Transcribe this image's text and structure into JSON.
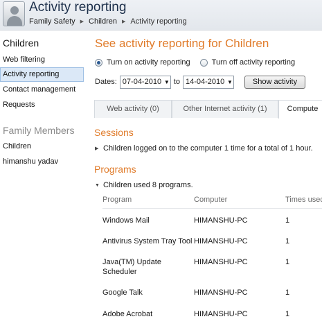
{
  "header": {
    "title": "Activity reporting",
    "breadcrumb": [
      "Family Safety",
      "Children",
      "Activity reporting"
    ]
  },
  "sidebar": {
    "heading": "Children",
    "items": [
      "Web filtering",
      "Activity reporting",
      "Contact management",
      "Requests"
    ],
    "active_index": 1,
    "members_heading": "Family Members",
    "members": [
      "Children",
      "himanshu yadav"
    ]
  },
  "main": {
    "title": "See activity reporting for Children",
    "radio_on": "Turn on activity reporting",
    "radio_off": "Turn off activity reporting",
    "radio_selected": "on",
    "dates_label": "Dates:",
    "date_from": "07-04-2010",
    "date_to_label": "to",
    "date_to": "14-04-2010",
    "show_button": "Show activity",
    "tabs": [
      "Web activity (0)",
      "Other Internet activity (1)",
      "Compute"
    ],
    "active_tab": 2,
    "sessions": {
      "title": "Sessions",
      "summary": "Children logged on to the computer 1 time for a total of 1 hour."
    },
    "programs": {
      "title": "Programs",
      "summary": "Children used 8 programs.",
      "columns": [
        "Program",
        "Computer",
        "Times used"
      ],
      "rows": [
        {
          "program": "Windows Mail",
          "computer": "HIMANSHU-PC",
          "times": "1"
        },
        {
          "program": "Antivirus System Tray Tool",
          "computer": "HIMANSHU-PC",
          "times": "1"
        },
        {
          "program": "Java(TM) Update",
          "program2": "Scheduler",
          "computer": "HIMANSHU-PC",
          "times": "1"
        },
        {
          "program": "Google Talk",
          "computer": "HIMANSHU-PC",
          "times": "1"
        },
        {
          "program": "Adobe Acrobat",
          "computer": "HIMANSHU-PC",
          "times": "1"
        }
      ]
    }
  },
  "colors": {
    "accent_orange": "#e07b2a",
    "selection_blue": "#dbe8f7"
  }
}
